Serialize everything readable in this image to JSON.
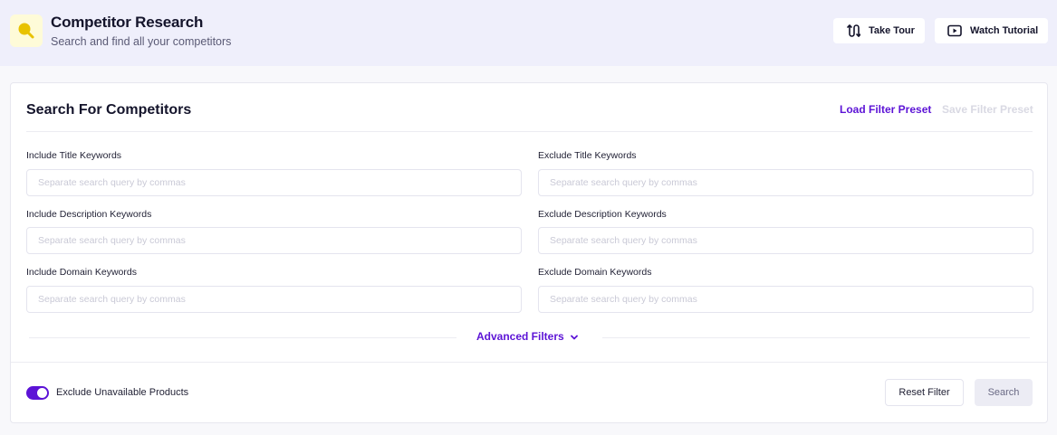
{
  "header": {
    "title": "Competitor Research",
    "subtitle": "Search and find all your competitors",
    "logo_icon": "magnifier-icon",
    "take_tour_label": "Take Tour",
    "watch_tutorial_label": "Watch Tutorial"
  },
  "card": {
    "title": "Search For Competitors",
    "load_preset_label": "Load Filter Preset",
    "save_preset_label": "Save Filter Preset"
  },
  "fields": {
    "include_title": {
      "label": "Include Title Keywords",
      "placeholder": "Separate search query by commas",
      "value": ""
    },
    "exclude_title": {
      "label": "Exclude Title Keywords",
      "placeholder": "Separate search query by commas",
      "value": ""
    },
    "include_description": {
      "label": "Include Description Keywords",
      "placeholder": "Separate search query by commas",
      "value": ""
    },
    "exclude_description": {
      "label": "Exclude Description Keywords",
      "placeholder": "Separate search query by commas",
      "value": ""
    },
    "include_domain": {
      "label": "Include Domain Keywords",
      "placeholder": "Separate search query by commas",
      "value": ""
    },
    "exclude_domain": {
      "label": "Exclude Domain Keywords",
      "placeholder": "Separate search query by commas",
      "value": ""
    }
  },
  "advanced_filters_label": "Advanced Filters",
  "footer": {
    "exclude_unavailable_label": "Exclude Unavailable Products",
    "exclude_unavailable_on": true,
    "reset_label": "Reset Filter",
    "search_label": "Search"
  },
  "colors": {
    "accent": "#5c13d6",
    "header_bg": "#efeffb",
    "logo_bg": "#fefbd8",
    "logo_icon": "#e8c200"
  }
}
